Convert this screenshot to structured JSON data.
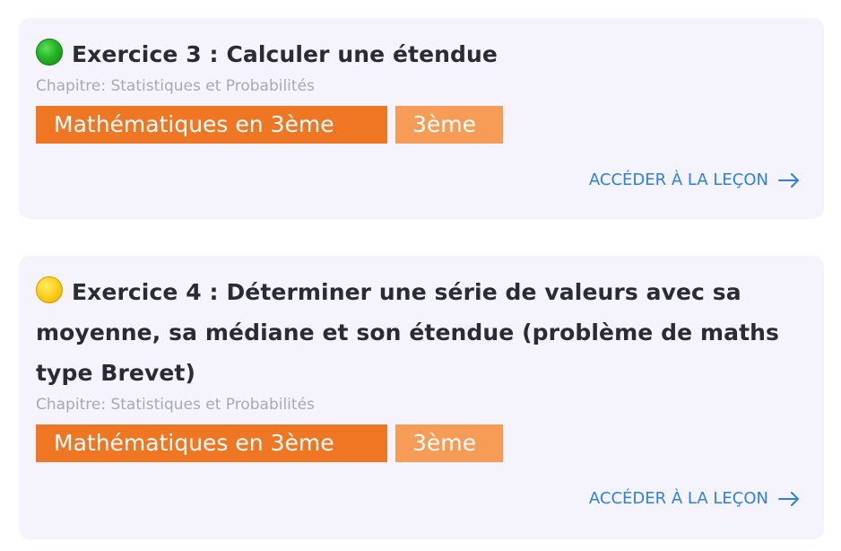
{
  "exercises": [
    {
      "status_icon": "green-circle-icon",
      "status_color": "#25b525",
      "title": "Exercice 3 : Calculer une étendue",
      "chapter": "Chapitre: Statistiques et Probabilités",
      "tags": [
        "Mathématiques en 3ème",
        "3ème"
      ],
      "link_label": "ACCÉDER À LA LEÇON"
    },
    {
      "status_icon": "yellow-circle-icon",
      "status_color": "#ffd21c",
      "title": "Exercice 4 : Déterminer une série de valeurs avec sa moyenne, sa médiane et son étendue (problème de maths type Brevet)",
      "chapter": "Chapitre: Statistiques et Probabilités",
      "tags": [
        "Mathématiques en 3ème",
        "3ème"
      ],
      "link_label": "ACCÉDER À LA LEÇON"
    }
  ],
  "colors": {
    "card_background": "#f5f4fd",
    "title": "#2b2b35",
    "chapter": "#a7a7bb",
    "tag_primary": "#ef7622",
    "tag_secondary": "#f79c57",
    "link": "#2f7fe0"
  }
}
